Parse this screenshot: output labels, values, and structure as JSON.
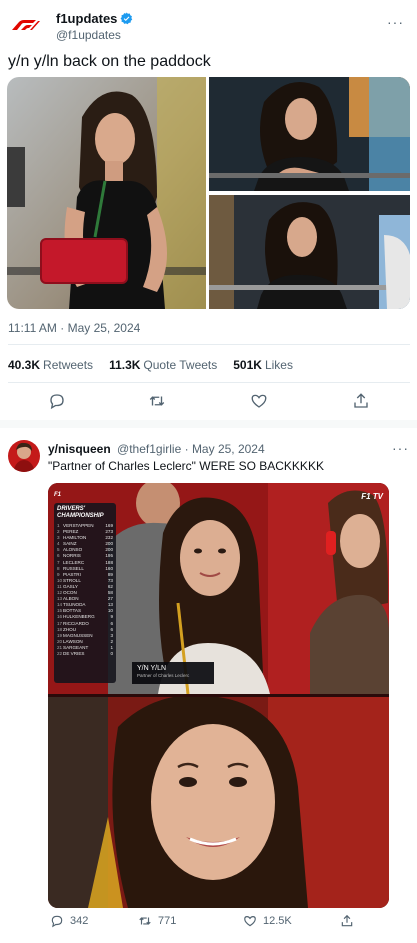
{
  "tweet1": {
    "display_name": "f1updates",
    "handle": "@f1updates",
    "verified_icon": "verified-badge-icon",
    "text": "y/n y/ln back on the paddock",
    "timestamp": "11:11 AM · May 25, 2024",
    "stats": {
      "retweets_count": "40.3K",
      "retweets_label": "Retweets",
      "quotes_count": "11.3K",
      "quotes_label": "Quote Tweets",
      "likes_count": "501K",
      "likes_label": "Likes"
    },
    "actions": [
      "reply-icon",
      "retweet-icon",
      "like-icon",
      "share-icon"
    ]
  },
  "tweet2": {
    "display_name": "y/nisqueen",
    "handle": "@thef1girlie",
    "date": "May 25, 2024",
    "text": "\"Partner of Charles Leclerc\" WERE SO BACKKKKK",
    "overlay": {
      "standings_title": "DRIVERS' CHAMPIONSHIP",
      "lower_third_name": "Y/N Y/LN",
      "lower_third_sub": "Partner of Charles Leclerc",
      "broadcaster": "F1 TV",
      "f1_logo_text": "F1"
    },
    "standings": [
      {
        "pos": "1",
        "driver": "VERSTAPPEN",
        "pts": "169"
      },
      {
        "pos": "2",
        "driver": "PEREZ",
        "pts": "273"
      },
      {
        "pos": "3",
        "driver": "HAMILTON",
        "pts": "232"
      },
      {
        "pos": "4",
        "driver": "SAINZ",
        "pts": "200"
      },
      {
        "pos": "5",
        "driver": "ALONSO",
        "pts": "200"
      },
      {
        "pos": "6",
        "driver": "NORRIS",
        "pts": "195"
      },
      {
        "pos": "7",
        "driver": "LECLERC",
        "pts": "188"
      },
      {
        "pos": "8",
        "driver": "RUSSELL",
        "pts": "160"
      },
      {
        "pos": "9",
        "driver": "PIASTRI",
        "pts": "89"
      },
      {
        "pos": "10",
        "driver": "STROLL",
        "pts": "73"
      },
      {
        "pos": "11",
        "driver": "GASLY",
        "pts": "62"
      },
      {
        "pos": "12",
        "driver": "OCON",
        "pts": "58"
      },
      {
        "pos": "13",
        "driver": "ALBON",
        "pts": "27"
      },
      {
        "pos": "14",
        "driver": "TSUNODA",
        "pts": "13"
      },
      {
        "pos": "15",
        "driver": "BOTTAS",
        "pts": "10"
      },
      {
        "pos": "16",
        "driver": "HULKENBERG",
        "pts": "9"
      },
      {
        "pos": "17",
        "driver": "RICCIARDO",
        "pts": "6"
      },
      {
        "pos": "18",
        "driver": "ZHOU",
        "pts": "6"
      },
      {
        "pos": "19",
        "driver": "MAGNUSSEN",
        "pts": "3"
      },
      {
        "pos": "20",
        "driver": "LAWSON",
        "pts": "2"
      },
      {
        "pos": "21",
        "driver": "SARGEANT",
        "pts": "1"
      },
      {
        "pos": "22",
        "driver": "DE VRIES",
        "pts": "0"
      }
    ],
    "actions": {
      "replies": "342",
      "retweets": "771",
      "likes": "12.5K"
    }
  },
  "colors": {
    "f1_red": "#e10600",
    "verified_blue": "#1d9bf0",
    "muted_text": "#536471",
    "primary_text": "#0f1419"
  }
}
